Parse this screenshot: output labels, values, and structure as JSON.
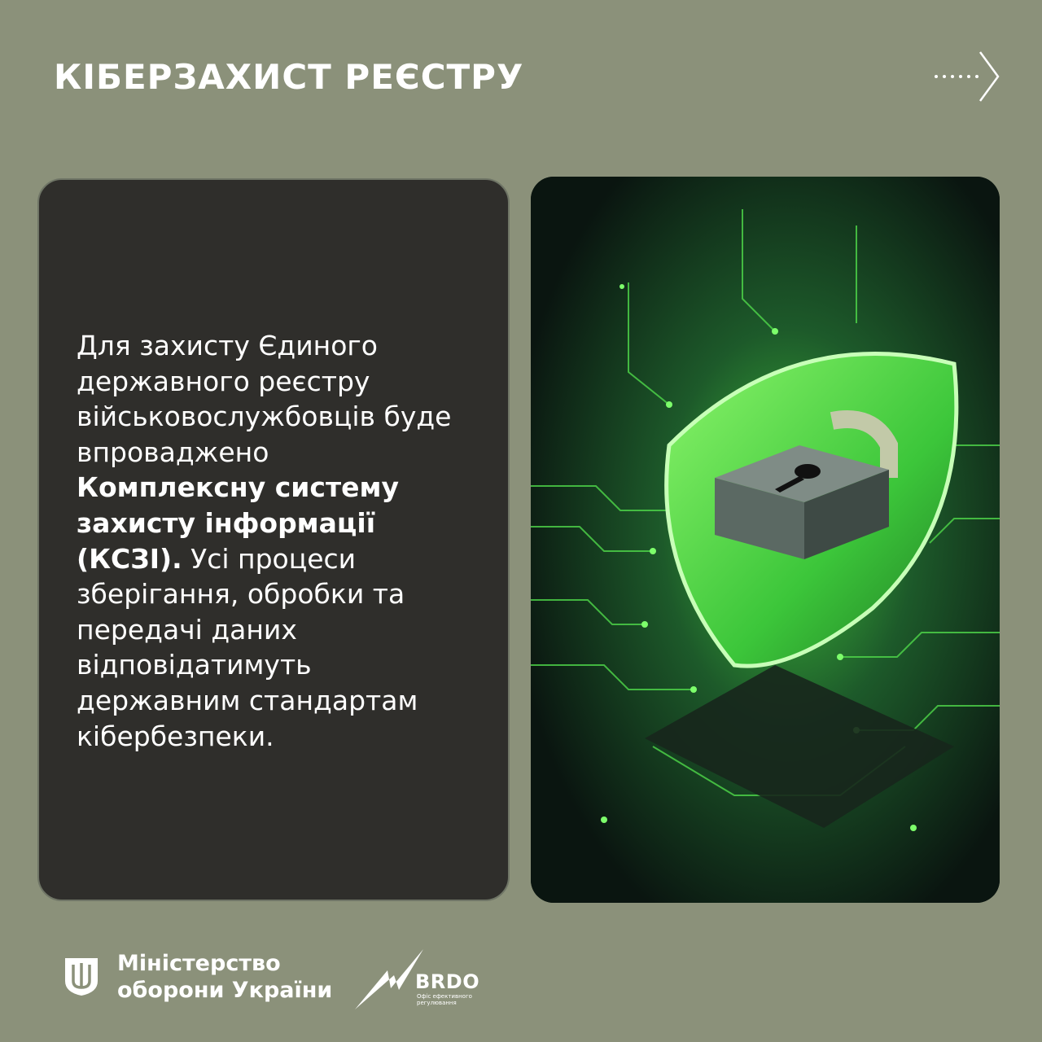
{
  "header": {
    "title": "КІБЕРЗАХИСТ РЕЄСТРУ",
    "next_icon": "dotted-arrow-right-icon"
  },
  "card": {
    "text_before_bold": "Для захисту Єдиного державного реєстру військовослужбовців буде впроваджено ",
    "text_bold": "Комплексну систему захисту інформації (КСЗІ).",
    "text_after_bold": " Усі процеси зберігання, обробки та передачі даних відповідатимуть державним стандартам кібербезпеки."
  },
  "image": {
    "subject": "shield-padlock-circuit-board"
  },
  "footer": {
    "ministry_line1": "Міністерство",
    "ministry_line2": "оборони України",
    "ministry_emblem": "trident-emblem-icon",
    "brdo_name": "BRDO",
    "brdo_subtitle_line1": "Офіс ефективного",
    "brdo_subtitle_line2": "регулювання",
    "brdo_logo": "lightning-logo-icon"
  },
  "colors": {
    "background": "#8b917a",
    "card": "#2f2e2b",
    "text": "#ffffff",
    "accent_green": "#5ee35a"
  }
}
